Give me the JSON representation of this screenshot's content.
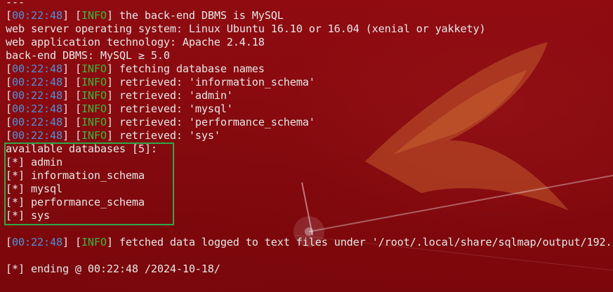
{
  "terminal": {
    "top_fragment": "---",
    "lines": [
      {
        "ts": "00:22:48",
        "level": "INFO",
        "msg": " the back-end DBMS is MySQL"
      },
      {
        "plain": "web server operating system: Linux Ubuntu 16.10 or 16.04 (xenial or yakkety)"
      },
      {
        "plain": "web application technology: Apache 2.4.18"
      },
      {
        "plain": "back-end DBMS: MySQL ≥ 5.0"
      },
      {
        "ts": "00:22:48",
        "level": "INFO",
        "msg": " fetching database names"
      },
      {
        "ts": "00:22:48",
        "level": "INFO",
        "msg": " retrieved: 'information_schema'"
      },
      {
        "ts": "00:22:48",
        "level": "INFO",
        "msg": " retrieved: 'admin'"
      },
      {
        "ts": "00:22:48",
        "level": "INFO",
        "msg": " retrieved: 'mysql'"
      },
      {
        "ts": "00:22:48",
        "level": "INFO",
        "msg": " retrieved: 'performance_schema'"
      },
      {
        "ts": "00:22:48",
        "level": "INFO",
        "msg": " retrieved: 'sys'"
      },
      {
        "plain": "available databases [5]:"
      },
      {
        "plain": "[*] admin"
      },
      {
        "plain": "[*] information_schema"
      },
      {
        "plain": "[*] mysql"
      },
      {
        "plain": "[*] performance_schema"
      },
      {
        "plain": "[*] sys"
      },
      {
        "plain": ""
      },
      {
        "ts": "00:22:48",
        "level": "INFO",
        "msg": " fetched data logged to text files under '/root/.local/share/sqlmap/output/192."
      },
      {
        "plain": ""
      },
      {
        "plain": "[*] ending @ 00:22:48 /2024-10-18/"
      }
    ]
  },
  "colors": {
    "background": "#86090d",
    "text": "#e6e6e6",
    "timestamp": "#4d8fd6",
    "info_level": "#3fb43c",
    "highlight_border": "#2ea84a"
  }
}
